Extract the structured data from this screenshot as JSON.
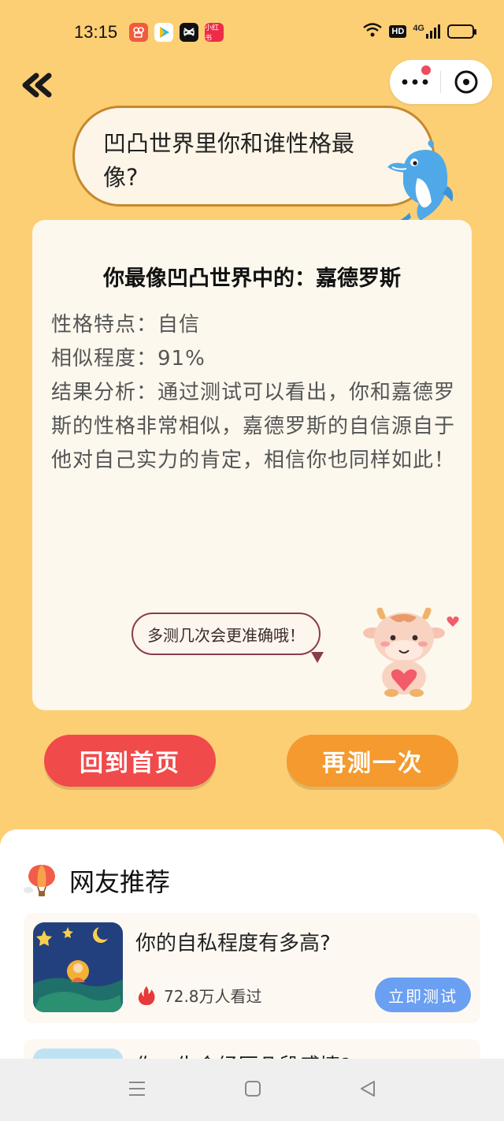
{
  "status_bar": {
    "time": "13:15",
    "app_badges": [
      {
        "icon": "kuaishou-icon",
        "color": "#f15a3f"
      },
      {
        "icon": "video-play-icon",
        "color": "#2bb5e8"
      },
      {
        "icon": "capcut-icon",
        "color": "#111111"
      },
      {
        "icon": "xiaohongshu-icon",
        "color": "#ee2b47",
        "label": "小红书"
      }
    ],
    "hd": "HD",
    "network": "4G"
  },
  "header": {
    "back_icon": "double-chevron-left-icon",
    "more_icon": "more-dots-icon",
    "close_icon": "close-circle-icon"
  },
  "question": {
    "text": "凹凸世界里你和谁性格最像?"
  },
  "result": {
    "title": "你最像凹凸世界中的：嘉德罗斯",
    "trait": "性格特点：自信",
    "similarity": "相似程度：91%",
    "analysis": "结果分析：通过测试可以看出，你和嘉德罗斯的性格非常相似，嘉德罗斯的自信源自于他对自己实力的肯定，相信你也同样如此！"
  },
  "speech": {
    "text": "多测几次会更准确哦！"
  },
  "buttons": {
    "home": "回到首页",
    "retry": "再测一次"
  },
  "recommend": {
    "title": "网友推荐",
    "items": [
      {
        "title": "你的自私程度有多高?",
        "views": "72.8万人看过",
        "button": "立即测试"
      },
      {
        "title": "你一生会经历几段感情?"
      }
    ]
  },
  "colors": {
    "background": "#fdcf74",
    "card": "#fdf8ee",
    "home_button": "#f04a4a",
    "retry_button": "#f49a2e",
    "test_button": "#6a9ff2"
  }
}
